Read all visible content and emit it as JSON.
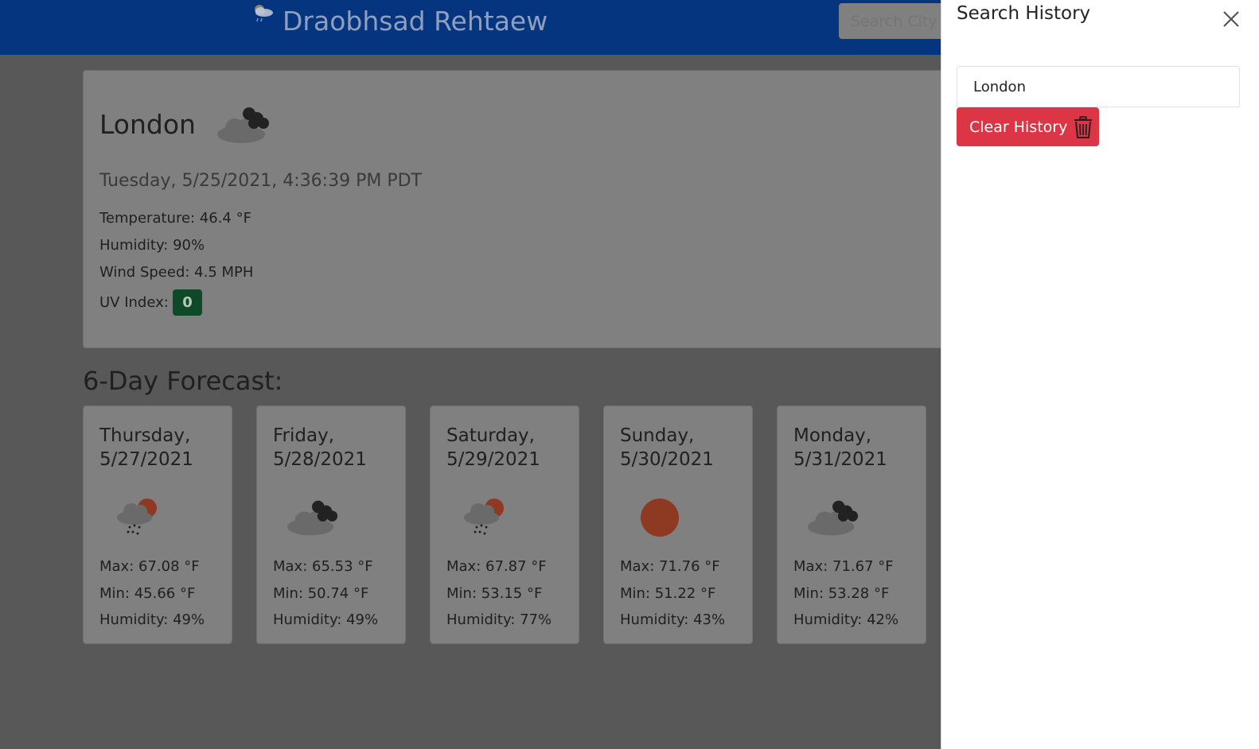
{
  "navbar": {
    "title": "Draobhsad Rehtaew",
    "search_placeholder": "Search City"
  },
  "current": {
    "city": "London",
    "icon": "cloudy-icon",
    "datetime": "Tuesday, 5/25/2021, 4:36:39 PM PDT",
    "temperature": "Temperature: 46.4 °F",
    "humidity": "Humidity: 90%",
    "wind": "Wind Speed: 4.5 MPH",
    "uv_label": "UV Index:",
    "uv_value": "0",
    "uv_color": "#0f4a28"
  },
  "forecast": {
    "heading": "6-Day Forecast:",
    "days": [
      {
        "day": "Thursday,",
        "date": "5/27/2021",
        "icon": "rain-sun-icon",
        "max": "Max: 67.08 °F",
        "min": "Min: 45.66 °F",
        "humidity": "Humidity: 49%"
      },
      {
        "day": "Friday,",
        "date": "5/28/2021",
        "icon": "cloudy-icon",
        "max": "Max: 65.53 °F",
        "min": "Min: 50.74 °F",
        "humidity": "Humidity: 49%"
      },
      {
        "day": "Saturday,",
        "date": "5/29/2021",
        "icon": "rain-sun-icon",
        "max": "Max: 67.87 °F",
        "min": "Min: 53.15 °F",
        "humidity": "Humidity: 77%"
      },
      {
        "day": "Sunday,",
        "date": "5/30/2021",
        "icon": "sun-icon",
        "max": "Max: 71.76 °F",
        "min": "Min: 51.22 °F",
        "humidity": "Humidity: 43%"
      },
      {
        "day": "Monday,",
        "date": "5/31/2021",
        "icon": "cloudy-icon",
        "max": "Max: 71.67 °F",
        "min": "Min: 53.28 °F",
        "humidity": "Humidity: 42%"
      }
    ]
  },
  "sidebar": {
    "title": "Search History",
    "history": [
      "London"
    ],
    "clear_label": "Clear History",
    "clear_color": "#dc3545"
  }
}
